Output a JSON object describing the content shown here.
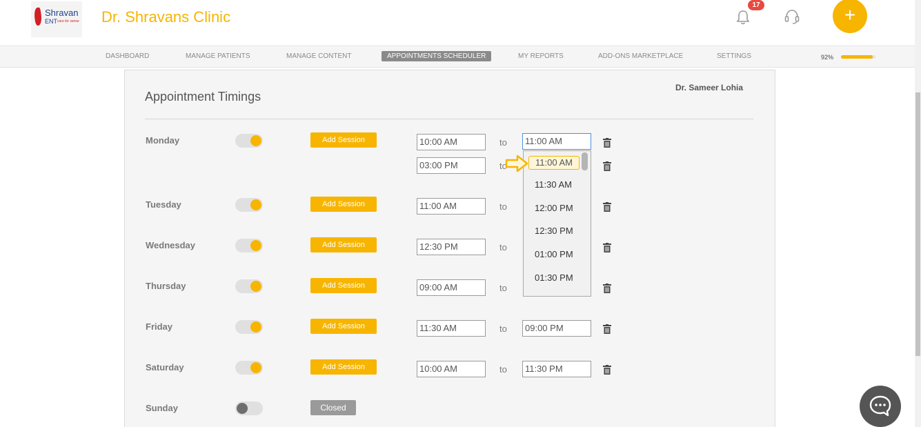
{
  "header": {
    "logo_line1": "Shravan",
    "logo_line2": "ENT",
    "logo_tagline": "care for sense",
    "clinic_name": "Dr. Shravans Clinic",
    "notification_count": "17",
    "add_label": "+"
  },
  "nav": {
    "items": [
      {
        "label": "DASHBOARD"
      },
      {
        "label": "MANAGE PATIENTS"
      },
      {
        "label": "MANAGE CONTENT"
      },
      {
        "label": "APPOINTMENTS SCHEDULER"
      },
      {
        "label": "MY REPORTS"
      },
      {
        "label": "ADD-ONS MARKETPLACE"
      },
      {
        "label": "SETTINGS"
      }
    ],
    "active_item": "APPOINTMENTS SCHEDULER",
    "progress_text": "92%",
    "progress_fraction": 0.92
  },
  "panel": {
    "title": "Appointment Timings",
    "doctor": "Dr. Sameer Lohia",
    "to_label": "to",
    "add_session_label": "Add Session",
    "closed_label": "Closed"
  },
  "days": [
    {
      "name": "Monday",
      "enabled": true,
      "sessions": [
        {
          "from": "10:00 AM",
          "to": "11:00 AM"
        },
        {
          "from": "03:00 PM",
          "to": ""
        }
      ]
    },
    {
      "name": "Tuesday",
      "enabled": true,
      "sessions": [
        {
          "from": "11:00 AM",
          "to": ""
        }
      ]
    },
    {
      "name": "Wednesday",
      "enabled": true,
      "sessions": [
        {
          "from": "12:30 PM",
          "to": ""
        }
      ]
    },
    {
      "name": "Thursday",
      "enabled": true,
      "sessions": [
        {
          "from": "09:00 AM",
          "to": ""
        }
      ]
    },
    {
      "name": "Friday",
      "enabled": true,
      "sessions": [
        {
          "from": "11:30 AM",
          "to": "09:00 PM"
        }
      ]
    },
    {
      "name": "Saturday",
      "enabled": true,
      "sessions": [
        {
          "from": "10:00 AM",
          "to": "11:30 PM"
        }
      ]
    },
    {
      "name": "Sunday",
      "enabled": false,
      "sessions": []
    }
  ],
  "dropdown": {
    "selected": "11:00 AM",
    "options": [
      "11:30 AM",
      "12:00 PM",
      "12:30 PM",
      "01:00 PM",
      "01:30 PM"
    ]
  },
  "colors": {
    "accent": "#f7b500",
    "badge": "#e84a3f",
    "closed": "#9a9a9a"
  }
}
